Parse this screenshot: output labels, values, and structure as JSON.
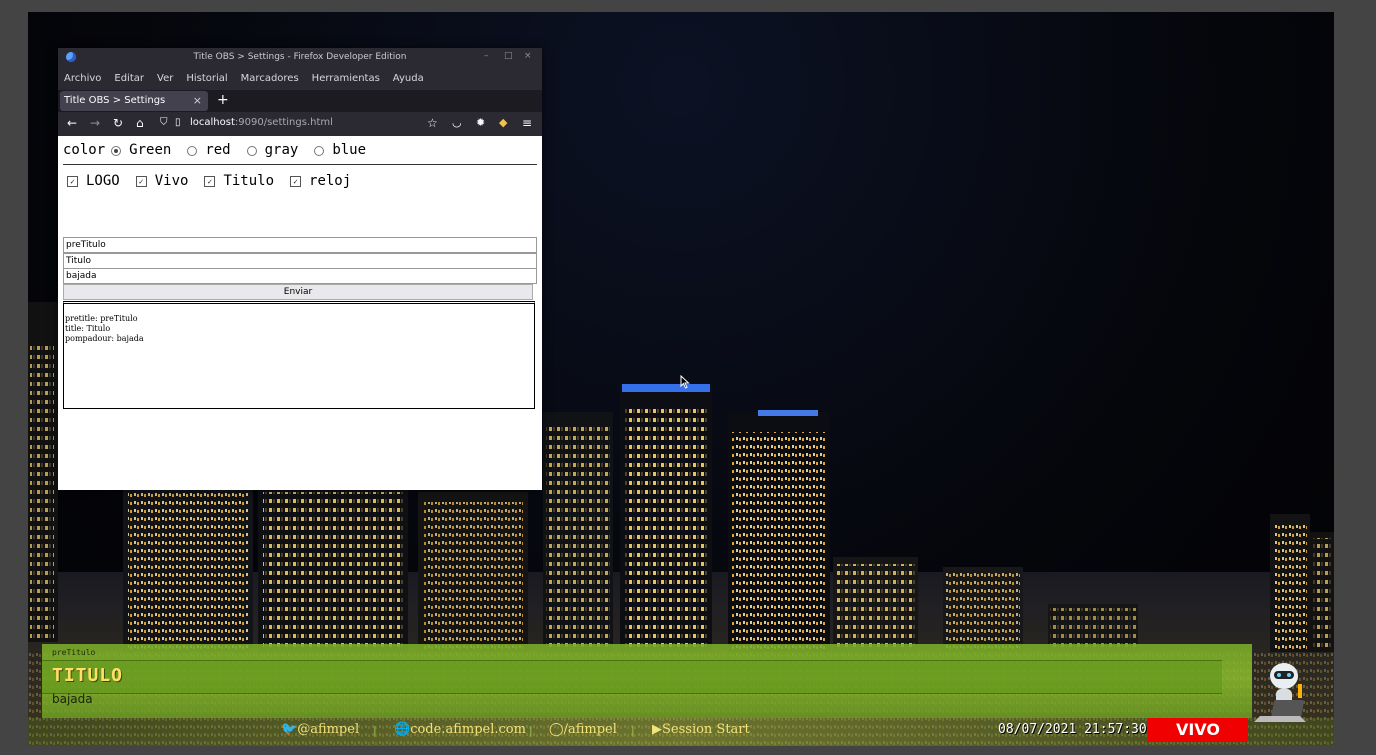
{
  "firefox": {
    "window_title": "Title OBS > Settings - Firefox Developer Edition",
    "window_controls": [
      "–",
      "□",
      "×"
    ],
    "menu": [
      "Archivo",
      "Editar",
      "Ver",
      "Historial",
      "Marcadores",
      "Herramientas",
      "Ayuda"
    ],
    "tab_label": "Title OBS > Settings",
    "url_host": "localhost",
    "url_rest": ":9090/settings.html",
    "icons": [
      "back-icon",
      "forward-icon",
      "reload-icon",
      "home-icon",
      "shield-icon",
      "page-icon",
      "bookmark-star-icon",
      "pocket-icon",
      "extension-icon",
      "extension-icon",
      "menu-icon"
    ]
  },
  "settings": {
    "color_label": "color",
    "colors": [
      {
        "label": "Green",
        "checked": true
      },
      {
        "label": "red",
        "checked": false
      },
      {
        "label": "gray",
        "checked": false
      },
      {
        "label": "blue",
        "checked": false
      }
    ],
    "checks": [
      {
        "label": "LOGO",
        "checked": true
      },
      {
        "label": "Vivo",
        "checked": true
      },
      {
        "label": "Titulo",
        "checked": true
      },
      {
        "label": "reloj",
        "checked": true
      }
    ],
    "pretitle_value": "preTitulo",
    "title_value": "Titulo",
    "bajada_value": "bajada",
    "submit_label": "Enviar",
    "output_lines": [
      "pretitle: preTitulo",
      "title: Titulo",
      "pompadour: bajada"
    ]
  },
  "overlay": {
    "pretitle": "preTitulo",
    "title": "TITULO",
    "bajada": "bajada",
    "twitter": "@afimpel",
    "web": "code.afimpel.com",
    "github": "/afimpel",
    "youtube": "Session Start",
    "clock": "08/07/2021 21:57:30",
    "live": "VIVO",
    "colors": {
      "band": "#8cbe2d",
      "live": "#f00000",
      "title": "#ffe066"
    }
  }
}
